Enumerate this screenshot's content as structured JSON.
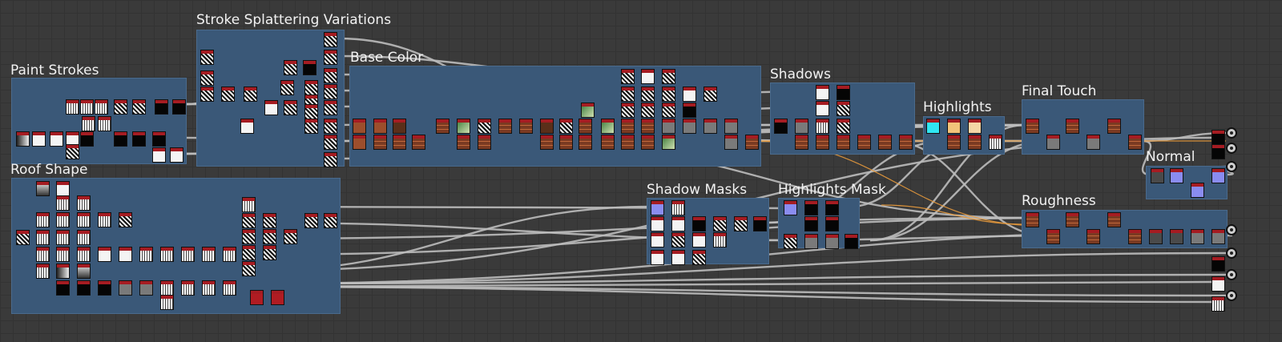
{
  "frames": [
    {
      "id": "paint-strokes",
      "title": "Paint Strokes"
    },
    {
      "id": "stroke-splattering",
      "title": "Stroke Splattering Variations"
    },
    {
      "id": "base-color",
      "title": "Base Color"
    },
    {
      "id": "roof-shape",
      "title": "Roof Shape"
    },
    {
      "id": "shadows",
      "title": "Shadows"
    },
    {
      "id": "highlights",
      "title": "Highlights"
    },
    {
      "id": "final-touch",
      "title": "Final Touch"
    },
    {
      "id": "normal",
      "title": "Normal"
    },
    {
      "id": "shadow-masks",
      "title": "Shadow Masks"
    },
    {
      "id": "highlights-mask",
      "title": "Highlights Mask"
    },
    {
      "id": "roughness",
      "title": "Roughness"
    }
  ],
  "colors": {
    "frame_fill": "#3a5878",
    "node_header": "#a51c22",
    "link": "#bdbdbd",
    "link_highlight": "#e89a3c",
    "canvas": "#3a3a3a"
  },
  "icons": {
    "graph_output": "output-node-icon",
    "node_header": "node-header-bar"
  }
}
